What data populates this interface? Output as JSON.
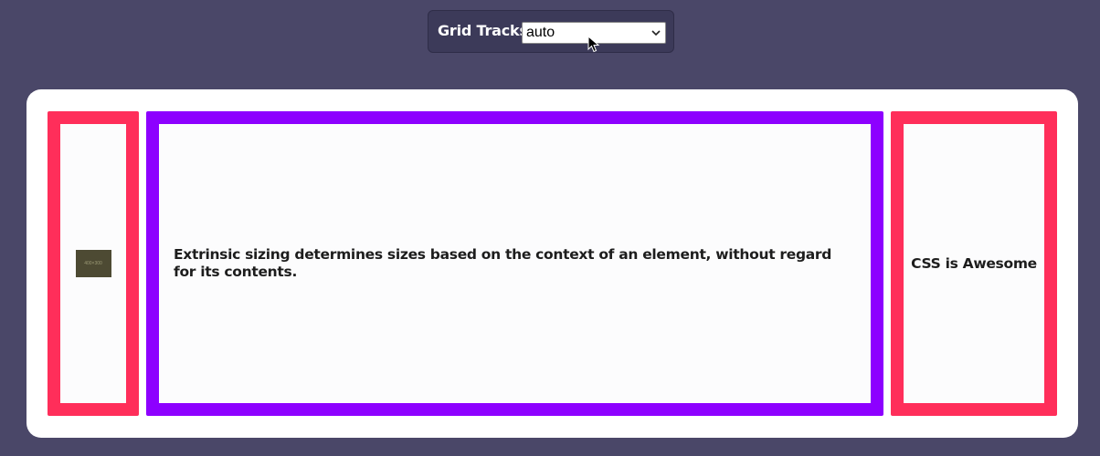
{
  "controls": {
    "label": "Grid Tracks:",
    "selected_value": "auto"
  },
  "grid": {
    "image_placeholder_text": "400×300",
    "middle_text": "Extrinsic sizing determines sizes based on the context of an element, without regard for its contents.",
    "right_text": "CSS is Awesome"
  },
  "colors": {
    "page_background": "#4a4768",
    "card_background": "#ffffff",
    "pink_border": "#ff2e5a",
    "purple_border": "#8d00ff"
  },
  "icons": {
    "select_arrow": "chevron-down-icon",
    "cursor": "cursor-icon"
  }
}
